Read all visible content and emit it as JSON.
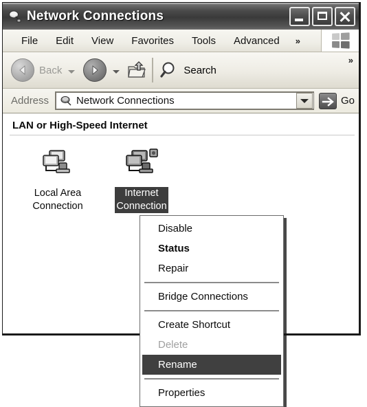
{
  "window": {
    "title": "Network Connections",
    "title_icon": "network-connections-icon",
    "caption": {
      "minimize_label": "Minimize",
      "maximize_label": "Maximize",
      "close_label": "Close"
    }
  },
  "menubar": {
    "items": [
      {
        "label": "File"
      },
      {
        "label": "Edit"
      },
      {
        "label": "View"
      },
      {
        "label": "Favorites"
      },
      {
        "label": "Tools"
      },
      {
        "label": "Advanced"
      }
    ],
    "overflow_label": "»",
    "branding_icon": "windows-flag-icon"
  },
  "toolbar": {
    "back_label": "Back",
    "back_icon": "arrow-left-icon",
    "forward_icon": "arrow-right-icon",
    "up_icon": "up-folder-icon",
    "search_label": "Search",
    "search_icon": "magnifier-icon",
    "overflow_label": "»"
  },
  "address": {
    "label": "Address",
    "value": "Network Connections",
    "placeholder": "Network Connections",
    "icon": "network-connections-icon",
    "dropdown_icon": "chevron-down-icon",
    "go_label": "Go",
    "go_icon": "arrow-right-icon"
  },
  "content": {
    "group_header": "LAN or High-Speed Internet",
    "connections": [
      {
        "label": "Local Area\nConnection",
        "icon": "network-connection-icon",
        "selected": false
      },
      {
        "label": "Internet\nConnection",
        "icon": "internet-connection-icon",
        "selected": true
      }
    ]
  },
  "context_menu": {
    "items": [
      {
        "label": "Disable",
        "state": "normal"
      },
      {
        "label": "Status",
        "state": "default"
      },
      {
        "label": "Repair",
        "state": "normal"
      },
      {
        "label": "",
        "state": "separator"
      },
      {
        "label": "Bridge Connections",
        "state": "normal"
      },
      {
        "label": "",
        "state": "separator"
      },
      {
        "label": "Create Shortcut",
        "state": "normal"
      },
      {
        "label": "Delete",
        "state": "disabled"
      },
      {
        "label": "Rename",
        "state": "highlighted"
      },
      {
        "label": "",
        "state": "separator"
      },
      {
        "label": "Properties",
        "state": "normal"
      }
    ]
  },
  "colors": {
    "titlebar_dark": "#3a3a3a",
    "selection": "#3d3d3d",
    "menu_highlight": "#404040",
    "chrome_face": "#ece9d8",
    "disabled_text": "#a0a0a0"
  }
}
